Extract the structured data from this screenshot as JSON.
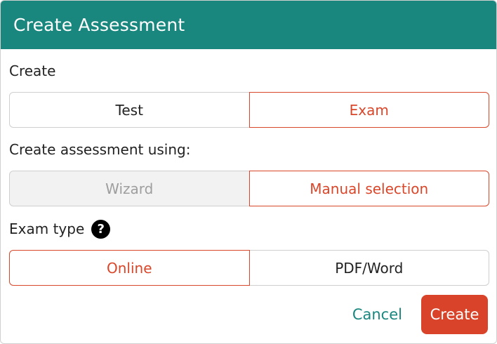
{
  "dialog": {
    "title": "Create Assessment"
  },
  "create_section": {
    "label": "Create",
    "options": [
      "Test",
      "Exam"
    ],
    "selected": "Exam"
  },
  "method_section": {
    "label": "Create assessment using:",
    "options": [
      "Wizard",
      "Manual selection"
    ],
    "selected": "Manual selection",
    "disabled": [
      "Wizard"
    ]
  },
  "exam_type_section": {
    "label": "Exam type",
    "help_icon": "question-circle-icon",
    "help_glyph": "?",
    "options": [
      "Online",
      "PDF/Word"
    ],
    "selected": "Online"
  },
  "footer": {
    "cancel_label": "Cancel",
    "create_label": "Create"
  },
  "colors": {
    "header_bg": "#1a877f",
    "accent": "#d9472b",
    "cancel_text": "#1a877f",
    "disabled_bg": "#f2f2f2"
  }
}
